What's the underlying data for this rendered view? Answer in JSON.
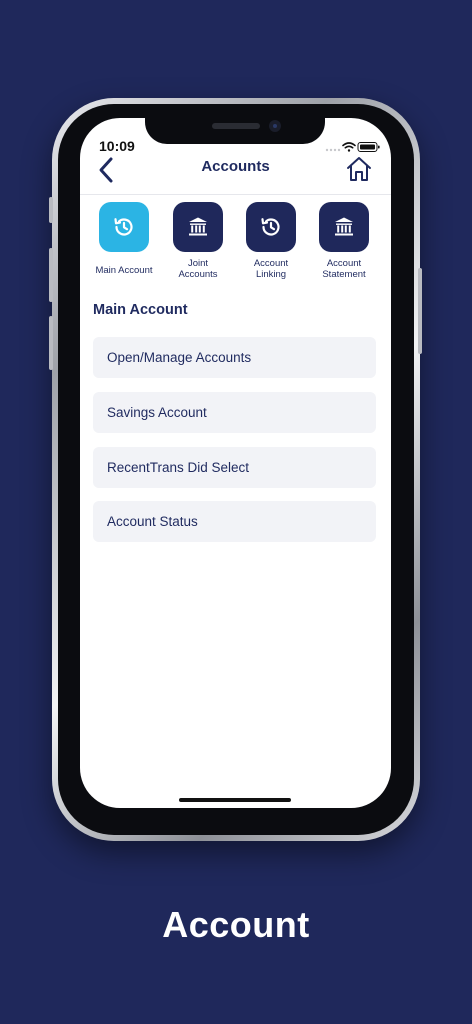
{
  "status_bar": {
    "time": "10:09"
  },
  "nav": {
    "title": "Accounts"
  },
  "tiles": [
    {
      "label": "Main Account",
      "icon": "history-icon",
      "active": true
    },
    {
      "label": "Joint\nAccounts",
      "icon": "bank-icon",
      "active": false
    },
    {
      "label": "Account\nLinking",
      "icon": "history-icon",
      "active": false
    },
    {
      "label": "Account\nStatement",
      "icon": "bank-icon",
      "active": false
    }
  ],
  "section": {
    "title": "Main Account"
  },
  "menu_items": [
    {
      "label": "Open/Manage Accounts"
    },
    {
      "label": "Savings Account"
    },
    {
      "label": "RecentTrans Did Select"
    },
    {
      "label": "Account Status"
    }
  ],
  "caption": "Account",
  "colors": {
    "background": "#1f285b",
    "active_tile": "#2bb4e4",
    "tile": "#1f285b",
    "list_bg": "#f2f3f7",
    "text": "#1f2a5f"
  }
}
